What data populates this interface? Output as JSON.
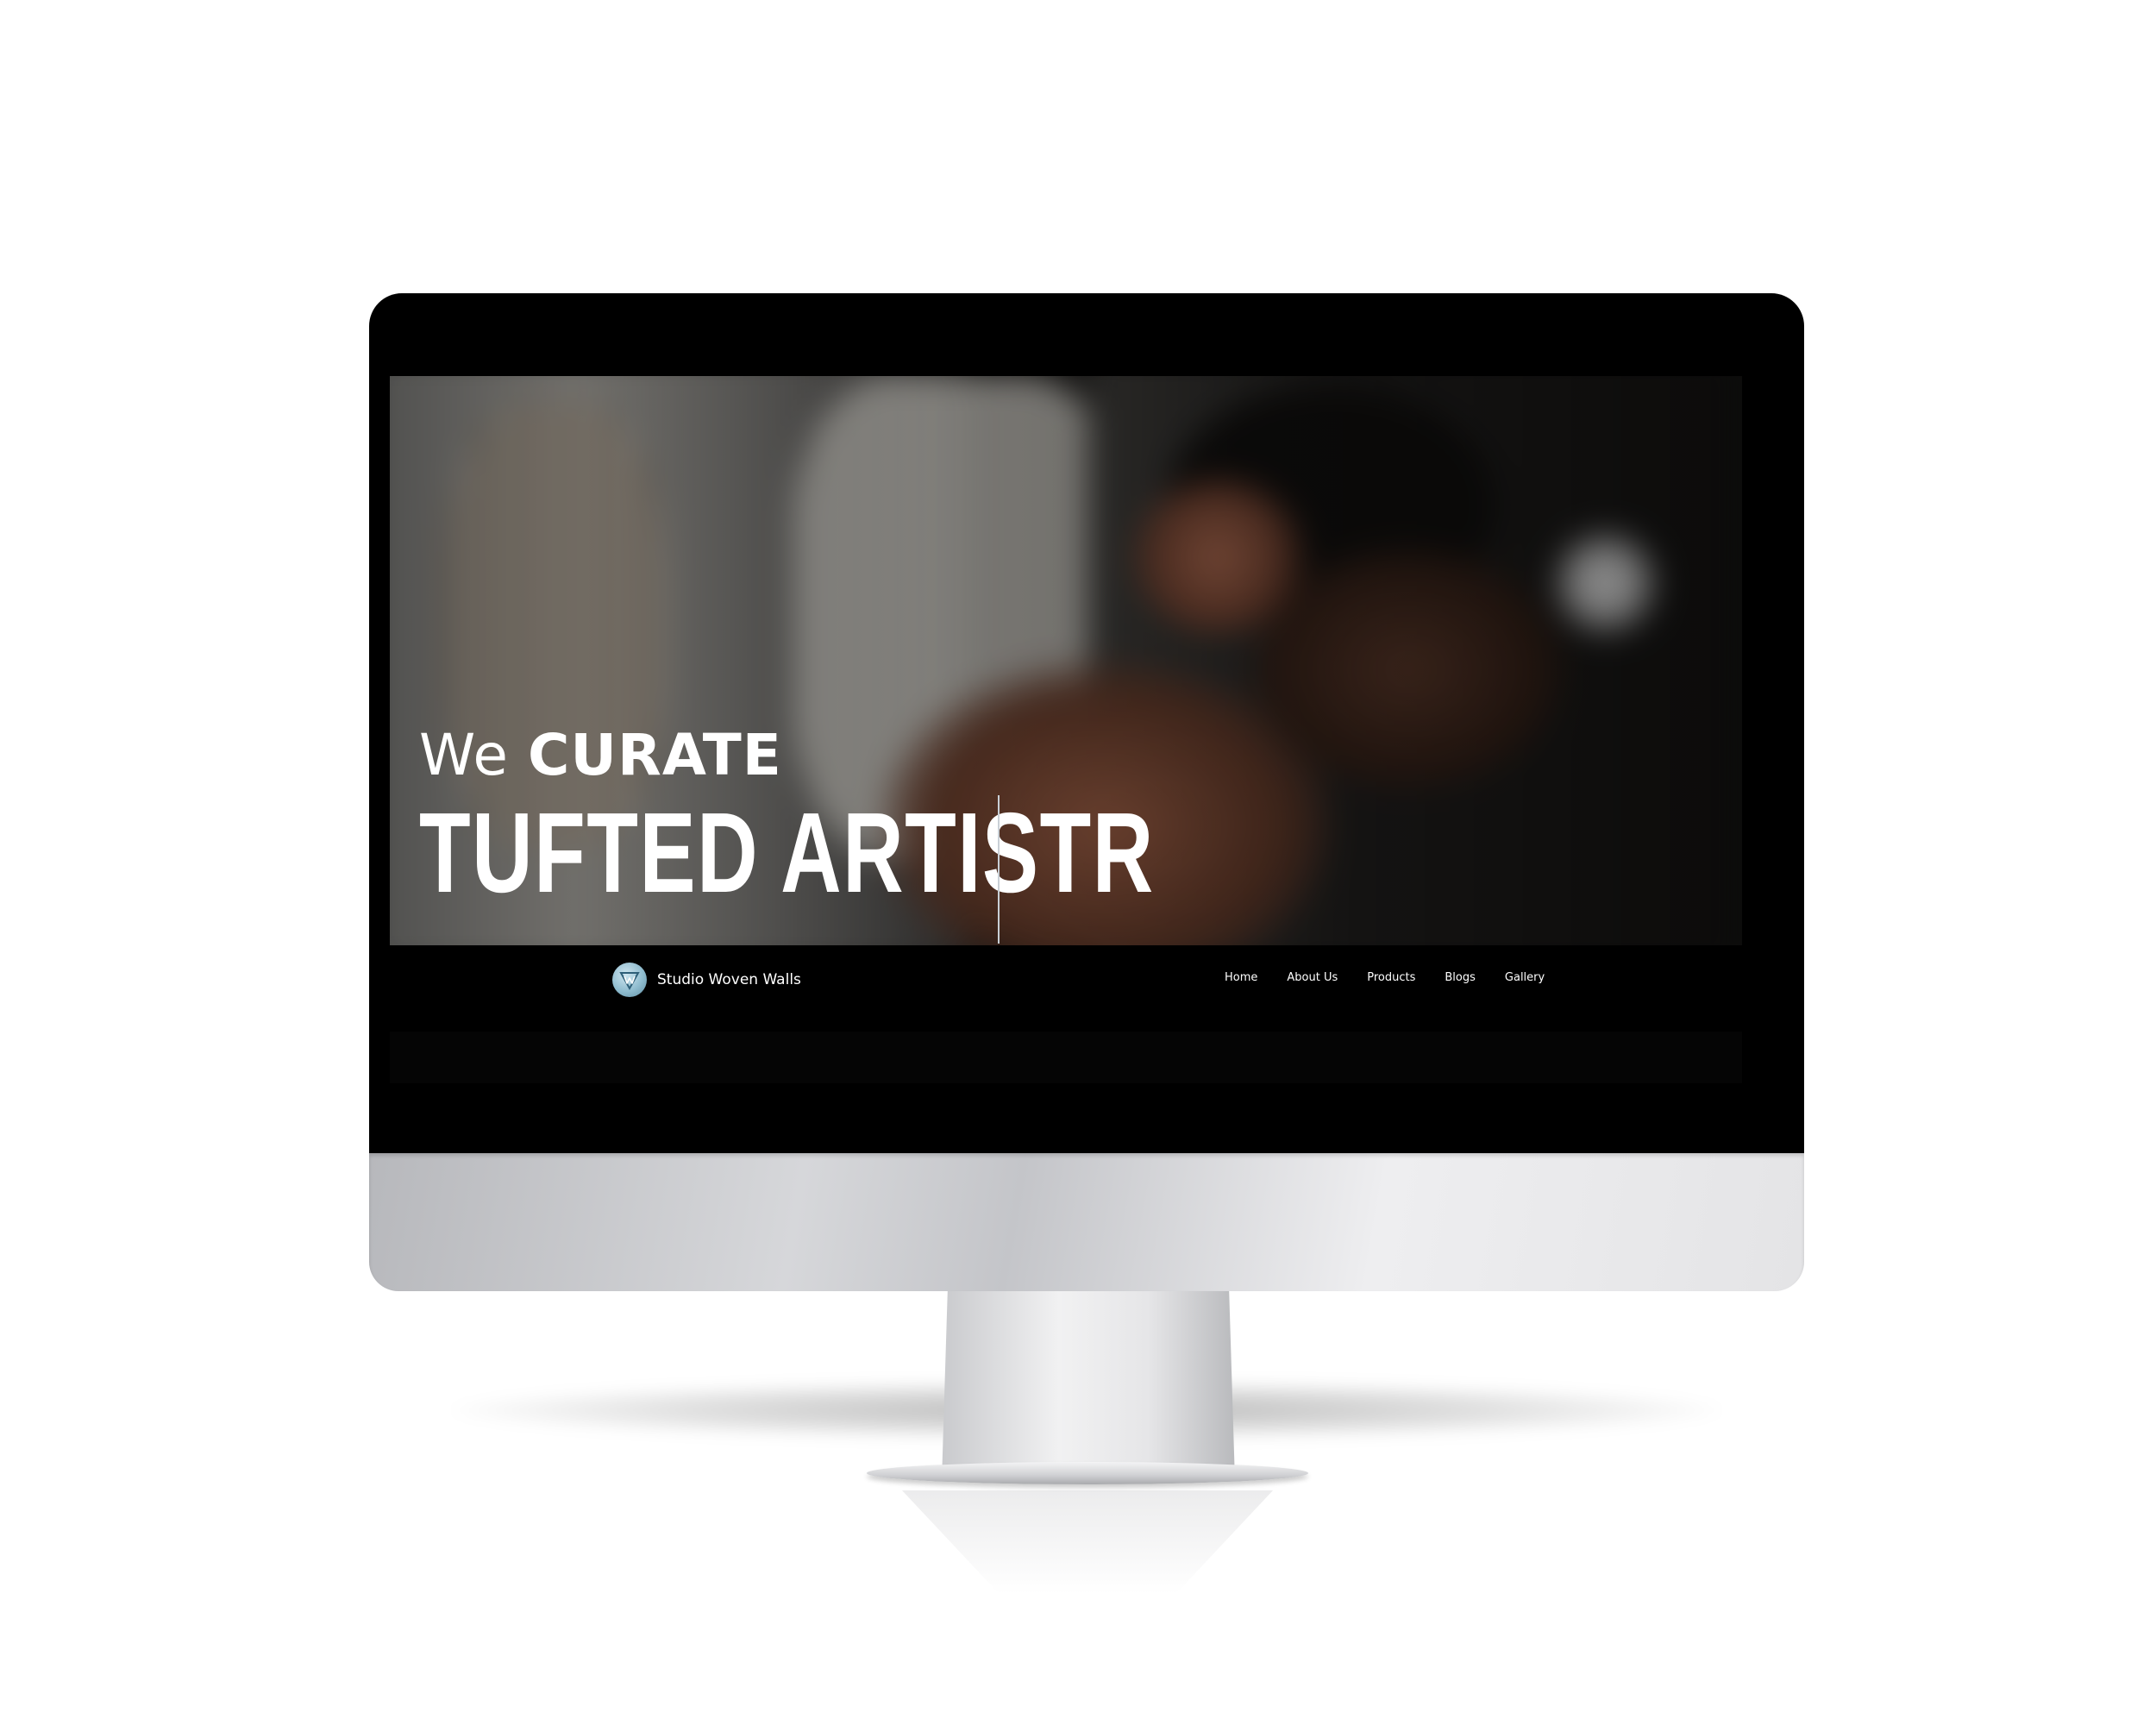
{
  "hero": {
    "line1_normal": "We ",
    "line1_strong": "CURATE",
    "line2": "TUFTED ARTISTR"
  },
  "brand": {
    "name": "Studio Woven Walls",
    "logo_icon": "woven-w-logo-icon",
    "logo_color": "#8fbccf"
  },
  "nav": {
    "items": [
      {
        "label": "Home"
      },
      {
        "label": "About Us"
      },
      {
        "label": "Products"
      },
      {
        "label": "Blogs"
      },
      {
        "label": "Gallery"
      }
    ]
  },
  "colors": {
    "screen_background": "#000000",
    "text": "#ffffff",
    "monitor_silver": "#d6d7da"
  }
}
